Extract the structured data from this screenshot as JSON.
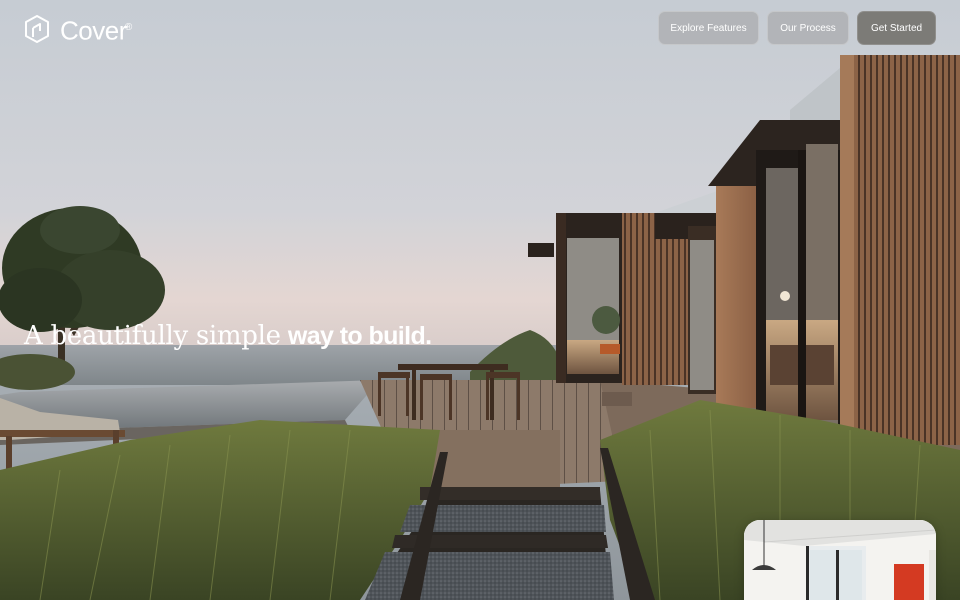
{
  "brand": {
    "name": "Cover",
    "mark": "®",
    "icon": "cover-logo-icon"
  },
  "nav": {
    "explore_label": "Explore Features",
    "process_label": "Our Process",
    "cta_label": "Get Started"
  },
  "hero": {
    "headline_light": "A beautifully simple",
    "headline_bold": "way to build."
  },
  "preview": {
    "icon": "interior-preview-thumbnail"
  },
  "colors": {
    "text": "#ffffff",
    "button": "#a0a0a0",
    "button_primary": "#6e6c66"
  }
}
